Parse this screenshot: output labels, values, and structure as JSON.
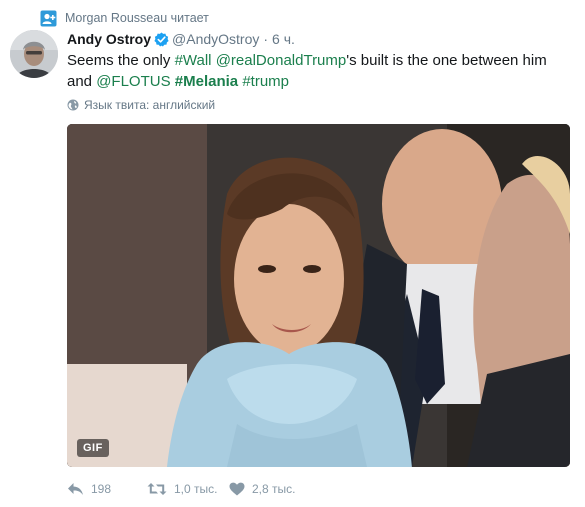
{
  "context": {
    "text": "Morgan Rousseau читает",
    "icon": "person-follow-icon"
  },
  "author": {
    "name": "Andy Ostroy",
    "verified": true,
    "handle": "@AndyOstroy",
    "separator": "·",
    "time": "6 ч."
  },
  "tweet": {
    "text_before": "Seems the only ",
    "tag_wall": "#Wall",
    "space1": " ",
    "mention_trump": "@realDonaldTrump",
    "text_middle": "'s built is the one between him and ",
    "mention_flotus": "@FLOTUS",
    "space2": " ",
    "tag_melania": "#Melania",
    "space3": " ",
    "tag_trump": "#trump"
  },
  "language": {
    "text": "Язык твита: английский",
    "icon": "globe-icon"
  },
  "media": {
    "badge": "GIF"
  },
  "actions": {
    "reply_count": "198",
    "retweet_count": "1,0 тыс.",
    "like_count": "2,8 тыс."
  },
  "colors": {
    "link": "#1b7f4d",
    "muted": "#657786",
    "verified": "#1da1f2"
  }
}
